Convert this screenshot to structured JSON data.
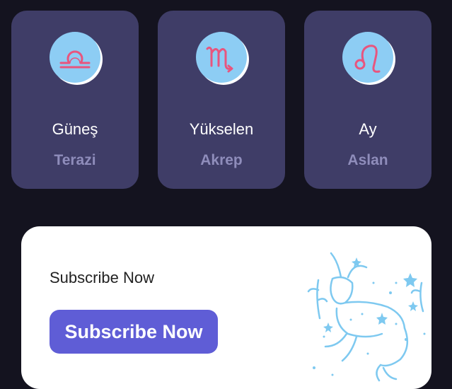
{
  "signs": [
    {
      "title": "Güneş",
      "value": "Terazi",
      "icon": "libra-icon"
    },
    {
      "title": "Yükselen",
      "value": "Akrep",
      "icon": "scorpio-icon"
    },
    {
      "title": "Ay",
      "value": "Aslan",
      "icon": "leo-icon"
    }
  ],
  "subscribe": {
    "title": "Subscribe Now",
    "button_label": "Subscribe Now",
    "illustration": "capricorn-goat-illustration"
  },
  "colors": {
    "background": "#14131f",
    "card": "#3f3d67",
    "card_value": "#8f8dbb",
    "icon_circle": "#8dcdf4",
    "icon_stroke": "#e8557e",
    "button": "#5f5dd6",
    "illustration": "#7ec9f0"
  }
}
